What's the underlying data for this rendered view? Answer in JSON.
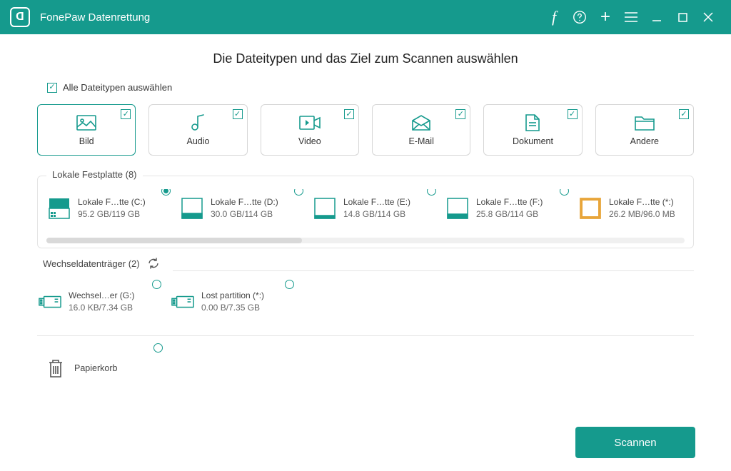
{
  "app": {
    "title": "FonePaw Datenrettung"
  },
  "heading": "Die Dateitypen und das Ziel zum Scannen auswählen",
  "selectAll": "Alle Dateitypen auswählen",
  "types": [
    {
      "label": "Bild"
    },
    {
      "label": "Audio"
    },
    {
      "label": "Video"
    },
    {
      "label": "E-Mail"
    },
    {
      "label": "Dokument"
    },
    {
      "label": "Andere"
    }
  ],
  "localDisk": {
    "title": "Lokale Festplatte (8)",
    "drives": [
      {
        "name": "Lokale F…tte (C:)",
        "size": "95.2 GB/119 GB"
      },
      {
        "name": "Lokale F…tte (D:)",
        "size": "30.0 GB/114 GB"
      },
      {
        "name": "Lokale F…tte (E:)",
        "size": "14.8 GB/114 GB"
      },
      {
        "name": "Lokale F…tte (F:)",
        "size": "25.8 GB/114 GB"
      },
      {
        "name": "Lokale F…tte (*:)",
        "size": "26.2 MB/96.0 MB"
      }
    ]
  },
  "removable": {
    "title": "Wechseldatenträger (2)",
    "drives": [
      {
        "name": "Wechsel…er (G:)",
        "size": "16.0 KB/7.34 GB"
      },
      {
        "name": "Lost partition (*:)",
        "size": "0.00  B/7.35 GB"
      }
    ]
  },
  "recycle": {
    "label": "Papierkorb"
  },
  "scanButton": "Scannen"
}
